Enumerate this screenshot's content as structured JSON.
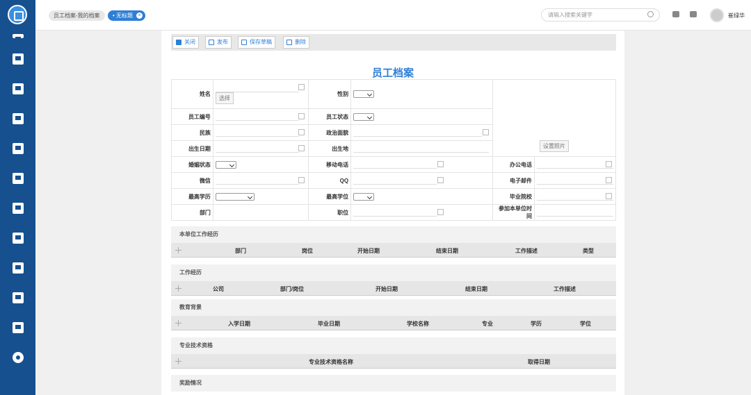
{
  "tabs": [
    {
      "label": "员工档案-我的档案",
      "active": false
    },
    {
      "label": "无标题",
      "active": true
    }
  ],
  "search": {
    "placeholder": "请输入搜索关键字"
  },
  "user": {
    "name": "崔绿华"
  },
  "sidebar": [
    "menu-icon",
    "contacts-icon",
    "news-icon",
    "calendar-icon",
    "user-settings-icon",
    "monitor-icon",
    "grid-icon",
    "panel-icon",
    "chart-icon",
    "screen-icon",
    "org-chart-icon",
    "gear-icon"
  ],
  "toolbar": {
    "close": "关闭",
    "publish": "发布",
    "save_draft": "保存草稿",
    "delete": "删除"
  },
  "doc_title": "员工档案",
  "form": {
    "name": "姓名",
    "select_btn": "选择",
    "gender": "性别",
    "photo_btn": "设置照片",
    "emp_no": "员工编号",
    "emp_status": "员工状态",
    "ethnicity": "民族",
    "political": "政治面貌",
    "birth_date": "出生日期",
    "birthplace": "出生地",
    "marital": "婚姻状态",
    "mobile": "移动电话",
    "office_phone": "办公电话",
    "wechat": "微信",
    "qq": "QQ",
    "email": "电子邮件",
    "education": "最高学历",
    "degree": "最高学位",
    "school": "毕业院校",
    "dept": "部门",
    "position": "职位",
    "join_date": "参加本单位时间"
  },
  "sections": [
    {
      "title": "本单位工作经历",
      "cols": [
        "部门",
        "岗位",
        "开始日期",
        "结束日期",
        "工作描述",
        "类型"
      ]
    },
    {
      "title": "工作经历",
      "cols": [
        "公司",
        "部门/岗位",
        "开始日期",
        "结束日期",
        "工作描述"
      ]
    },
    {
      "title": "教育背景",
      "cols": [
        "入学日期",
        "毕业日期",
        "学校名称",
        "专业",
        "学历",
        "学位"
      ]
    },
    {
      "title": "专业技术资格",
      "cols": [
        "专业技术资格名称",
        "取得日期"
      ]
    },
    {
      "title": "奖励情况",
      "cols": []
    }
  ]
}
